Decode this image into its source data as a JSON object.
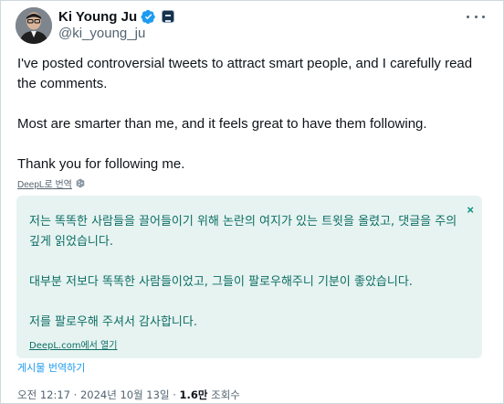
{
  "author": {
    "display_name": "Ki Young Ju",
    "handle": "@ki_young_ju",
    "verified": true
  },
  "tweet": {
    "text": "I've posted controversial tweets to attract smart people, and I carefully read the comments.\n\nMost are smarter than me, and it feels great to have them following.\n\nThank you for following me."
  },
  "deepl": {
    "label": "DeepL로 번역"
  },
  "translation": {
    "text": "저는 똑똑한 사람들을 끌어들이기 위해 논란의 여지가 있는 트윗을 올렸고, 댓글을 주의 깊게 읽었습니다.\n\n대부분 저보다 똑똑한 사람들이었고, 그들이 팔로우해주니 기분이 좋았습니다.\n\n저를 팔로우해 주셔서 감사합니다.",
    "open_link": "DeepL.com에서 열기",
    "close_symbol": "×"
  },
  "actions": {
    "translate_post": "게시물 번역하기"
  },
  "meta": {
    "time": "오전 12:17",
    "separator": "·",
    "date": "2024년 10월 13일",
    "views_count": "1.6만",
    "views_label": "조회수"
  },
  "colors": {
    "accent": "#1d9bf0",
    "translation_bg": "#e6f3f1",
    "translation_text": "#0d6e64"
  },
  "icons": [
    "avatar-photo",
    "verified-badge-icon",
    "affiliation-badge-icon",
    "more-options-icon",
    "deepl-logo-icon",
    "close-icon"
  ]
}
